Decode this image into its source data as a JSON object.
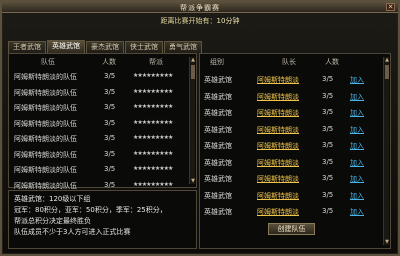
{
  "window": {
    "title": "帮派争霸赛",
    "close_label": "✕"
  },
  "countdown": {
    "label": "距离比赛开始有：",
    "value": "10分钟"
  },
  "tabs": [
    "王者武馆",
    "英雄武馆",
    "豪杰武馆",
    "侠士武馆",
    "勇气武馆"
  ],
  "active_tab": 1,
  "left_table": {
    "headers": {
      "team": "队伍",
      "count": "人数",
      "power": "帮派"
    },
    "rows": [
      {
        "team": "阿姆斯特朗淡的队伍",
        "count": "3/5",
        "power": "★★★★★★★★★"
      },
      {
        "team": "阿姆斯特朗淡的队伍",
        "count": "3/5",
        "power": "★★★★★★★★★"
      },
      {
        "team": "阿姆斯特朗淡的队伍",
        "count": "3/5",
        "power": "★★★★★★★★★"
      },
      {
        "team": "阿姆斯特朗淡的队伍",
        "count": "3/5",
        "power": "★★★★★★★★★"
      },
      {
        "team": "阿姆斯特朗淡的队伍",
        "count": "3/5",
        "power": "★★★★★★★★★"
      },
      {
        "team": "阿姆斯特朗淡的队伍",
        "count": "3/5",
        "power": "★★★★★★★★★"
      },
      {
        "team": "阿姆斯特朗淡的队伍",
        "count": "3/5",
        "power": "★★★★★★★★★"
      },
      {
        "team": "阿姆斯特朗淡的队伍",
        "count": "3/5",
        "power": "★★★★★★★★★"
      }
    ]
  },
  "right_table": {
    "headers": {
      "group": "组别",
      "captain": "队长",
      "count": "人数"
    },
    "rows": [
      {
        "group": "英雄武馆",
        "captain": "阿姆斯特朗淡",
        "count": "3/5",
        "action": "加入"
      },
      {
        "group": "英雄武馆",
        "captain": "阿姆斯特朗淡",
        "count": "3/5",
        "action": "加入"
      },
      {
        "group": "英雄武馆",
        "captain": "阿姆斯特朗淡",
        "count": "3/5",
        "action": "加入"
      },
      {
        "group": "英雄武馆",
        "captain": "阿姆斯特朗淡",
        "count": "3/5",
        "action": "加入"
      },
      {
        "group": "英雄武馆",
        "captain": "阿姆斯特朗淡",
        "count": "3/5",
        "action": "加入"
      },
      {
        "group": "英雄武馆",
        "captain": "阿姆斯特朗淡",
        "count": "3/5",
        "action": "加入"
      },
      {
        "group": "英雄武馆",
        "captain": "阿姆斯特朗淡",
        "count": "3/5",
        "action": "加入"
      },
      {
        "group": "英雄武馆",
        "captain": "阿姆斯特朗淡",
        "count": "3/5",
        "action": "加入"
      },
      {
        "group": "英雄武馆",
        "captain": "阿姆斯特朗淡",
        "count": "3/5",
        "action": "加入"
      }
    ]
  },
  "info": [
    "英雄武馆：120级以下组",
    "冠军：80积分，亚军：50积分，季军：25积分，",
    "帮派总积分决定最终胜负",
    "队伍成员不少于3人方可进入正式比赛"
  ],
  "create_button": "创建队伍",
  "scroll": {
    "up": "▲",
    "down": "▼"
  }
}
